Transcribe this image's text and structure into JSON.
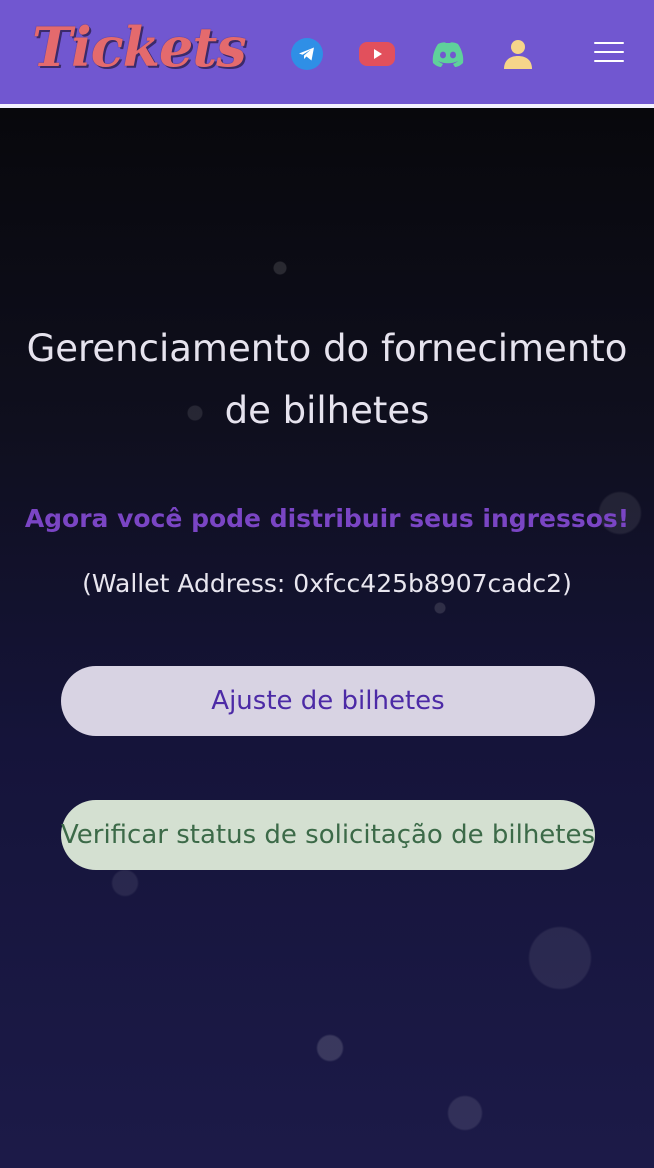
{
  "header": {
    "logo_text": "Tickets",
    "icons": [
      "telegram-icon",
      "youtube-icon",
      "discord-icon",
      "user-icon",
      "menu-icon"
    ],
    "colors": {
      "background": "#7157d0",
      "logo": "#e46a6d",
      "telegram": "#2f8fe6",
      "youtube": "#e2505c",
      "discord": "#5fd19b",
      "user": "#f6d58a"
    }
  },
  "main": {
    "title": "Gerenciamento do fornecimento de bilhetes",
    "subtitle": "Agora você pode distribuir seus ingressos!",
    "wallet": "(Wallet Address: 0xfcc425b8907cadc2)",
    "buttons": {
      "adjust_label": "Ajuste de bilhetes",
      "verify_label": "Verificar status de solicitação de bilhetes"
    },
    "colors": {
      "subtitle": "#7a45c4",
      "adjust_bg": "#d8d3e3",
      "adjust_text": "#4c2aa6",
      "verify_bg": "#d4e0d1",
      "verify_text": "#3c6a48"
    }
  }
}
